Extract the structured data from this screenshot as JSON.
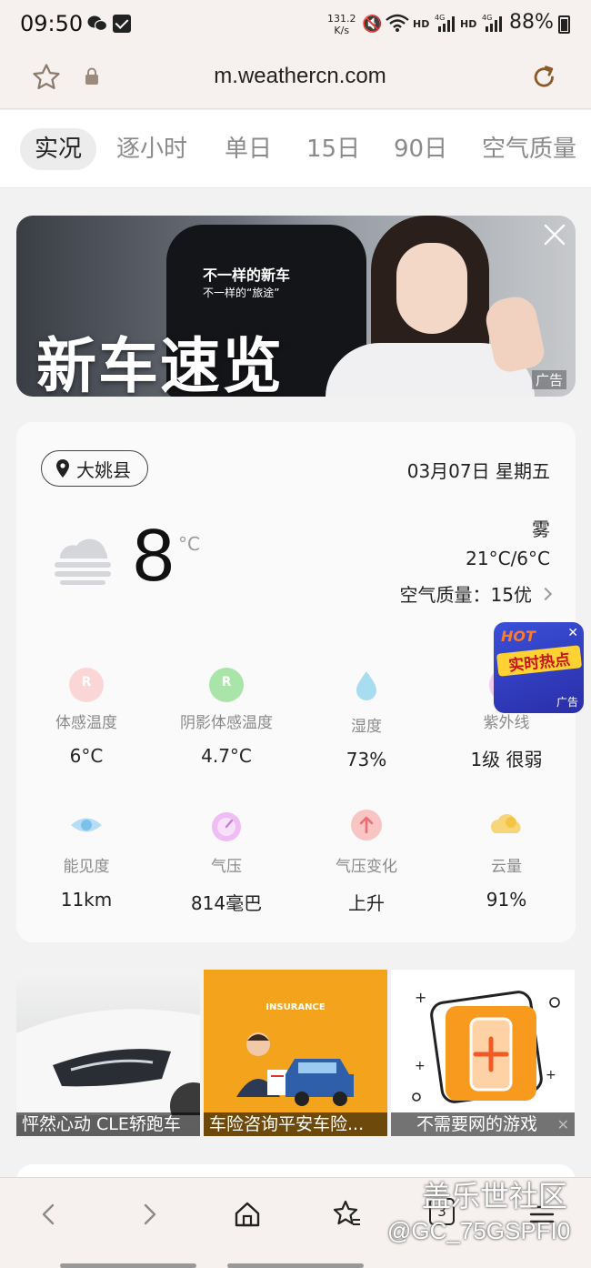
{
  "status_bar": {
    "time": "09:50",
    "net_speed_value": "131.2",
    "net_speed_unit": "K/s",
    "hd1": "HD",
    "hd2": "HD",
    "battery": "88%"
  },
  "address_bar": {
    "url": "m.weathercn.com"
  },
  "tabs": [
    {
      "label": "实况",
      "active": true
    },
    {
      "label": "逐小时"
    },
    {
      "label": "单日"
    },
    {
      "label": "15日"
    },
    {
      "label": "90日"
    },
    {
      "label": "空气质量"
    }
  ],
  "banner_ad": {
    "line1": "不一样的新车",
    "line2": "不一样的“旅途”",
    "headline": "新车速览",
    "ad_label": "广告"
  },
  "weather": {
    "location": "大姚县",
    "date": "03月07日 星期五",
    "temperature": "8",
    "unit": "°C",
    "condition": "雾",
    "range": "21°C/6°C",
    "air_quality": "空气质量：15优",
    "metrics": [
      {
        "label": "体感温度",
        "value": "6°C",
        "icon": "feels-like-icon",
        "color": "#f3b4b4"
      },
      {
        "label": "阴影体感温度",
        "value": "4.7°C",
        "icon": "shade-feels-like-icon",
        "color": "#8fdc8f"
      },
      {
        "label": "湿度",
        "value": "73%",
        "icon": "humidity-drop-icon",
        "color": "#8fd3ee"
      },
      {
        "label": "紫外线",
        "value": "1级 很弱",
        "icon": "uv-icon",
        "color": "#e6a8e6"
      },
      {
        "label": "能见度",
        "value": "11km",
        "icon": "visibility-eye-icon",
        "color": "#9ecff2"
      },
      {
        "label": "气压",
        "value": "814毫巴",
        "icon": "pressure-gauge-icon",
        "color": "#e6a8ee"
      },
      {
        "label": "气压变化",
        "value": "上升",
        "icon": "pressure-up-icon",
        "color": "#f5b0b0"
      },
      {
        "label": "云量",
        "value": "91%",
        "icon": "cloud-cover-icon",
        "color": "#f7d67a"
      }
    ]
  },
  "hot_ad": {
    "title": "HOT",
    "text": "实时热点",
    "ad_label": "广告"
  },
  "bottom_ads": [
    {
      "caption": "怦然心动 CLE轿跑车"
    },
    {
      "caption": "车险咨询平安车险...",
      "image_text": "INSURANCE"
    },
    {
      "caption": "不需要网的游戏"
    }
  ],
  "bottom_nav": {
    "tab_count": "3"
  },
  "watermark": {
    "line1": "盖乐世社区",
    "line2": "@GC_75GSPFI0"
  }
}
